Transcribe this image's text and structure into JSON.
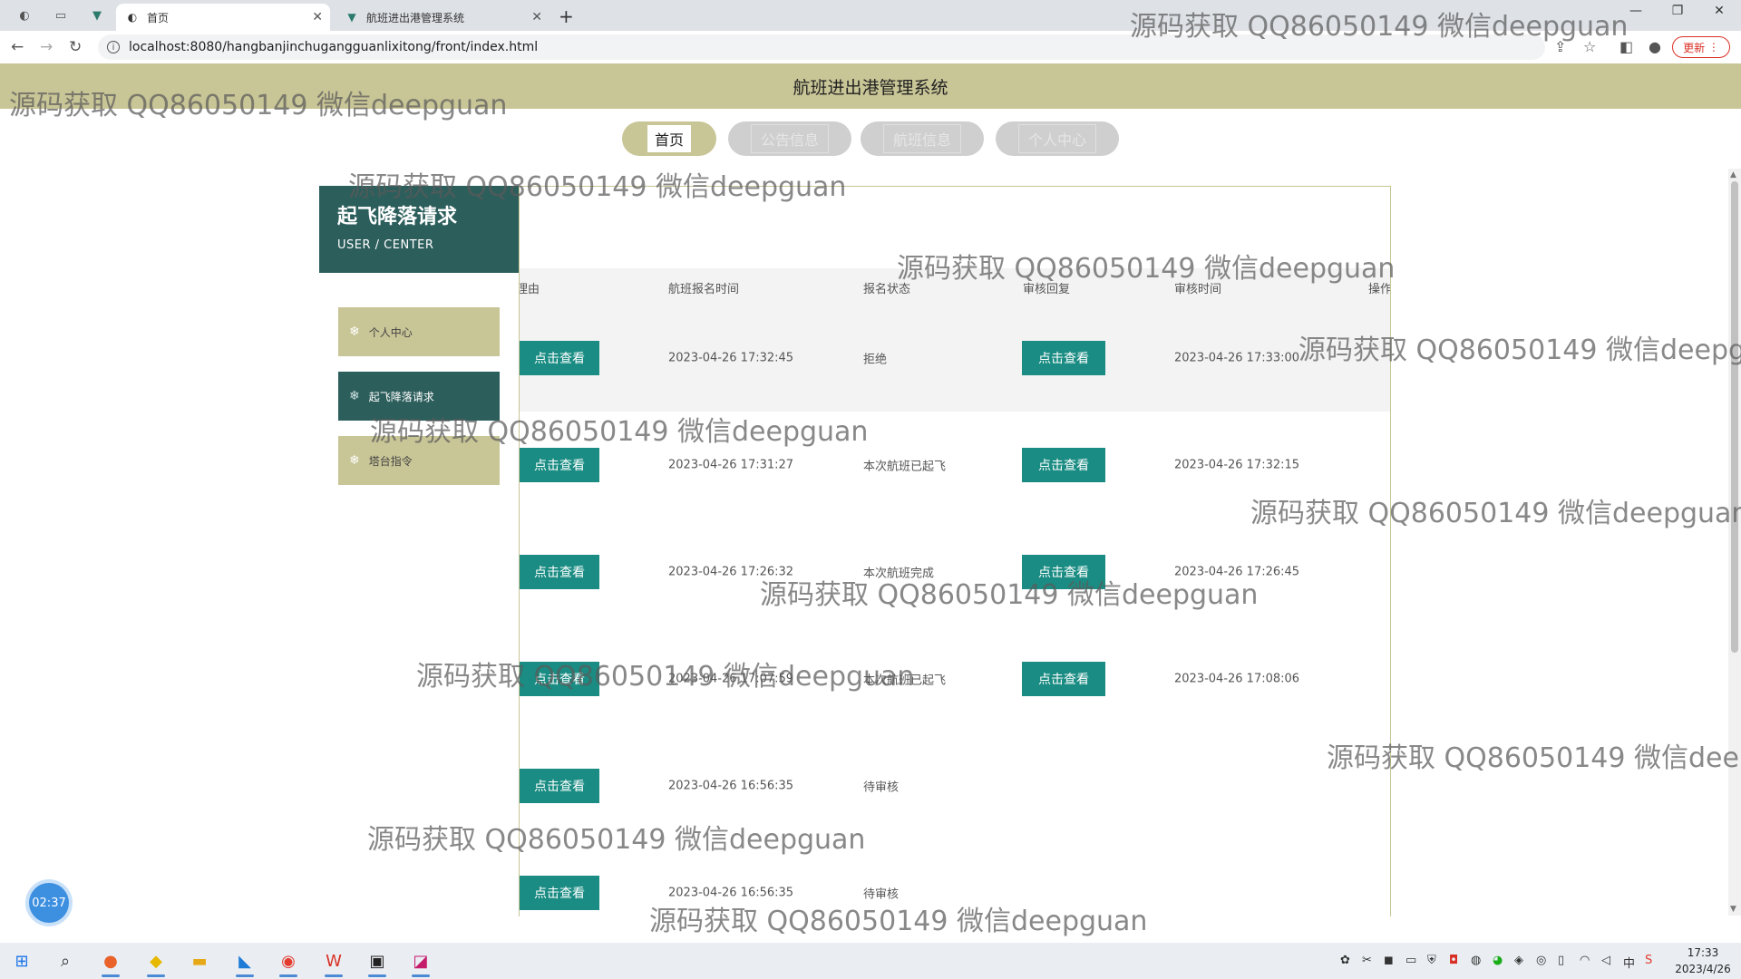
{
  "browser": {
    "tabs": [
      {
        "title": "首页",
        "active": true
      },
      {
        "title": "航班进出港管理系统",
        "active": false
      }
    ],
    "url": "localhost:8080/hangbanjinchugangguanlixitong/front/index.html",
    "update_label": "更新"
  },
  "site": {
    "title": "航班进出港管理系统",
    "nav": [
      {
        "label": "首页",
        "active": true
      },
      {
        "label": "公告信息",
        "active": false
      },
      {
        "label": "航班信息",
        "active": false
      },
      {
        "label": "个人中心",
        "active": false
      }
    ]
  },
  "sidebar": {
    "title": "起飞降落请求",
    "subtitle": "USER / CENTER",
    "items": [
      {
        "label": "个人中心",
        "active": false
      },
      {
        "label": "起飞降落请求",
        "active": true
      },
      {
        "label": "塔台指令",
        "active": false
      }
    ]
  },
  "table": {
    "headers": [
      "理由",
      "航班报名时间",
      "报名状态",
      "审核回复",
      "审核时间",
      "操作"
    ],
    "view_label": "点击查看",
    "rows": [
      {
        "time": "2023-04-26 17:32:45",
        "status": "拒绝",
        "reply_btn": true,
        "review_time": "2023-04-26 17:33:00"
      },
      {
        "time": "2023-04-26 17:31:27",
        "status": "本次航班已起飞",
        "reply_btn": true,
        "review_time": "2023-04-26 17:32:15"
      },
      {
        "time": "2023-04-26 17:26:32",
        "status": "本次航班完成",
        "reply_btn": true,
        "review_time": "2023-04-26 17:26:45"
      },
      {
        "time": "2023-04-26 17:07:59",
        "status": "本次航班已起飞",
        "reply_btn": true,
        "review_time": "2023-04-26 17:08:06"
      },
      {
        "time": "2023-04-26 16:56:35",
        "status": "待审核",
        "reply_btn": false,
        "review_time": ""
      },
      {
        "time": "2023-04-26 16:56:35",
        "status": "待审核",
        "reply_btn": false,
        "review_time": ""
      }
    ]
  },
  "watermark": "源码获取 QQ86050149 微信deepguan",
  "timer": "02:37",
  "taskbar": {
    "time": "17:33",
    "date": "2023/4/26",
    "ime": "中"
  }
}
